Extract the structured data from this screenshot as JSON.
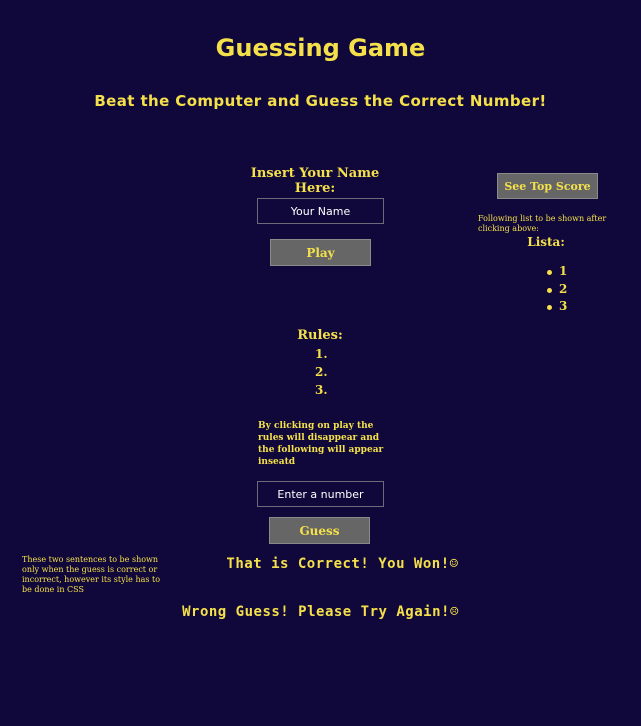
{
  "header": {
    "title": "Guessing Game",
    "subtitle": "Beat the Computer and Guess the Correct Number!"
  },
  "name_form": {
    "label": "Insert Your Name Here:",
    "placeholder": "Your Name",
    "play_label": "Play"
  },
  "top_score": {
    "button_label": "See Top Score",
    "note": "Following list to be shown after clicking above:",
    "list_title": "Lista:",
    "items": [
      "1",
      "2",
      "3"
    ]
  },
  "rules": {
    "title": "Rules:",
    "items": [
      "1.",
      "2.",
      "3."
    ],
    "note": "By clicking on play the rules will disappear and the following will appear inseatd"
  },
  "guess_form": {
    "placeholder": "Enter a number",
    "guess_label": "Guess"
  },
  "results": {
    "note": "These two sentences to be shown only when the guess is correct or incorrect, however its style has to be done in CSS",
    "correct": "That is Correct! You Won!☺",
    "wrong": "Wrong Guess! Please Try Again!☹"
  },
  "colors": {
    "background": "#10073a",
    "text": "#f4e04a",
    "button": "#666666"
  }
}
